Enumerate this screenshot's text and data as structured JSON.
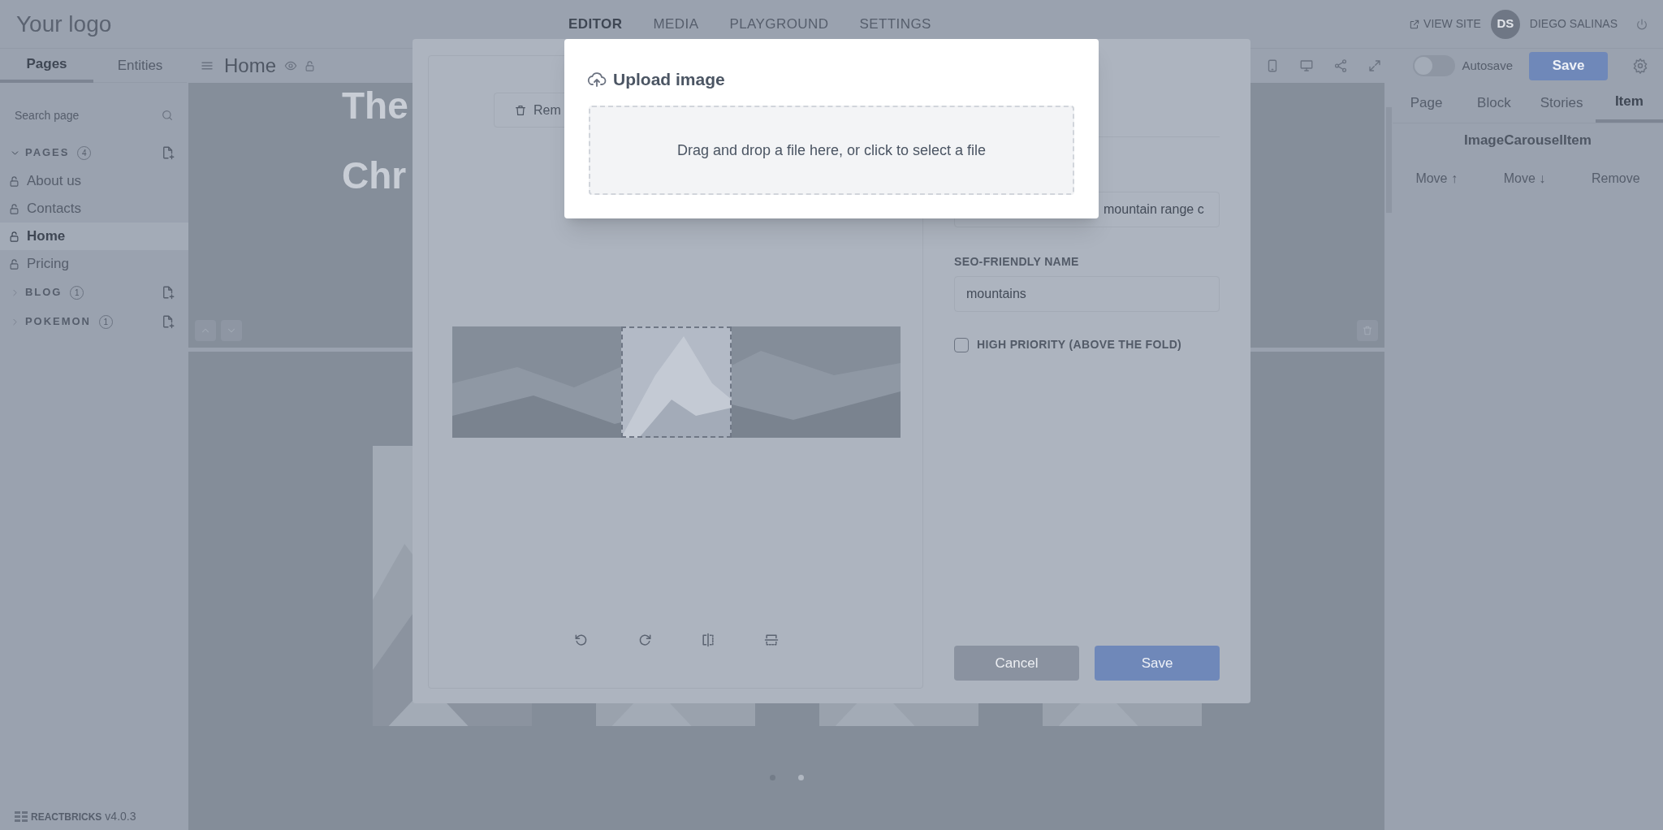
{
  "topbar": {
    "logo": "Your logo",
    "nav": [
      {
        "label": "EDITOR",
        "selected": true
      },
      {
        "label": "MEDIA",
        "selected": false
      },
      {
        "label": "PLAYGROUND",
        "selected": false
      },
      {
        "label": "SETTINGS",
        "selected": false
      }
    ],
    "view_site": "VIEW SITE",
    "avatar": "DS",
    "user": "DIEGO SALINAS"
  },
  "sidebar": {
    "tabs": [
      {
        "label": "Pages",
        "selected": true
      },
      {
        "label": "Entities",
        "selected": false
      }
    ],
    "search": {
      "placeholder": "Search page"
    },
    "sections": [
      {
        "label": "PAGES",
        "count": "4",
        "expanded": true,
        "items": [
          {
            "label": "About us",
            "selected": false
          },
          {
            "label": "Contacts",
            "selected": false
          },
          {
            "label": "Home",
            "selected": true
          },
          {
            "label": "Pricing",
            "selected": false
          }
        ]
      },
      {
        "label": "BLOG",
        "count": "1",
        "expanded": false
      },
      {
        "label": "POKEMON",
        "count": "1",
        "expanded": false
      }
    ],
    "footer": {
      "brand": "REACTBRICKS",
      "version": "v4.0.3"
    }
  },
  "toolbar": {
    "page_title": "Home",
    "autosave": {
      "label": "Autosave",
      "on": false
    },
    "save": "Save"
  },
  "canvas": {
    "hero_lines": [
      "The",
      "Chr"
    ],
    "dots": [
      {
        "selected": false
      },
      {
        "selected": true
      }
    ]
  },
  "right_panel": {
    "tabs": [
      {
        "label": "Page",
        "selected": false
      },
      {
        "label": "Block",
        "selected": false
      },
      {
        "label": "Stories",
        "selected": false
      },
      {
        "label": "Item",
        "selected": true
      }
    ],
    "heading": "ImageCarouselItem",
    "actions": [
      "Move ↑",
      "Move ↓",
      "Remove"
    ]
  },
  "image_editor": {
    "remove_button": "Rem",
    "alt_field": {
      "value": "mountain range c"
    },
    "seo_label": "SEO-FRIENDLY NAME",
    "seo_field": {
      "value": "mountains"
    },
    "priority": {
      "label": "HIGH PRIORITY (ABOVE THE FOLD)",
      "checked": false
    },
    "cancel": "Cancel",
    "save": "Save"
  },
  "upload_dialog": {
    "title": "Upload image",
    "dropzone": "Drag and drop a file here, or click to select a file"
  }
}
